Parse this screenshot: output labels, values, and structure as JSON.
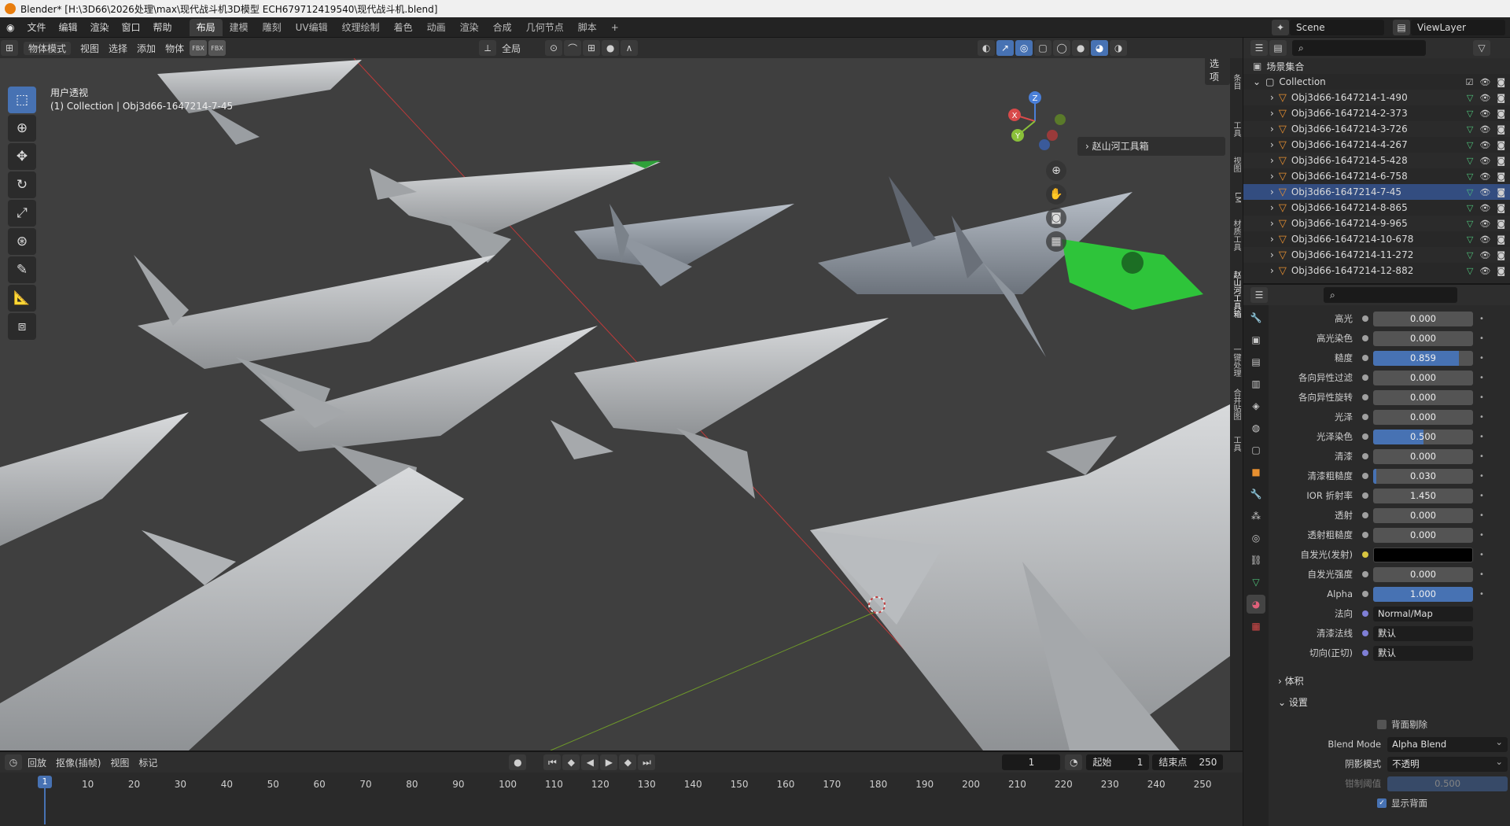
{
  "window": {
    "title": "Blender* [H:\\3D66\\2026处理\\max\\现代战斗机3D模型 ECH679712419540\\现代战斗机.blend]"
  },
  "topbar": {
    "menus": [
      "文件",
      "编辑",
      "渲染",
      "窗口",
      "帮助"
    ],
    "workspaces": [
      "布局",
      "建模",
      "雕刻",
      "UV编辑",
      "纹理绘制",
      "着色",
      "动画",
      "渲染",
      "合成",
      "几何节点",
      "脚本"
    ],
    "active_workspace": "布局",
    "add_tab": "+",
    "scene": "Scene",
    "view_layer": "ViewLayer"
  },
  "viewport_header": {
    "mode": "物体模式",
    "menus": [
      "视图",
      "选择",
      "添加",
      "物体"
    ],
    "transform_orientation": "全局",
    "options": "选项"
  },
  "viewport": {
    "view_name": "用户透视",
    "collection_info": "(1) Collection | Obj3d66-1647214-7-45",
    "npanel_title": "赵山河工具箱",
    "gizmo_axes": [
      "X",
      "Y",
      "Z"
    ],
    "side_tabs": [
      "条目",
      "工具",
      "视图",
      "LM",
      "材质工具",
      "赵山河工具箱",
      "一键处理",
      "合并贴图",
      "工具"
    ]
  },
  "outliner": {
    "scene_collection": "场景集合",
    "collection": "Collection",
    "objects": [
      "Obj3d66-1647214-1-490",
      "Obj3d66-1647214-2-373",
      "Obj3d66-1647214-3-726",
      "Obj3d66-1647214-4-267",
      "Obj3d66-1647214-5-428",
      "Obj3d66-1647214-6-758",
      "Obj3d66-1647214-7-45",
      "Obj3d66-1647214-8-865",
      "Obj3d66-1647214-9-965",
      "Obj3d66-1647214-10-678",
      "Obj3d66-1647214-11-272",
      "Obj3d66-1647214-12-882"
    ]
  },
  "properties": {
    "rows": [
      {
        "label": "高光",
        "value": "0.000",
        "fill": 0
      },
      {
        "label": "高光染色",
        "value": "0.000",
        "fill": 0
      },
      {
        "label": "糙度",
        "value": "0.859",
        "fill": 0.859
      },
      {
        "label": "各向异性过滤",
        "value": "0.000",
        "fill": 0
      },
      {
        "label": "各向异性旋转",
        "value": "0.000",
        "fill": 0
      },
      {
        "label": "光泽",
        "value": "0.000",
        "fill": 0
      },
      {
        "label": "光泽染色",
        "value": "0.500",
        "fill": 0.5
      },
      {
        "label": "清漆",
        "value": "0.000",
        "fill": 0
      },
      {
        "label": "清漆粗糙度",
        "value": "0.030",
        "fill": 0.03
      },
      {
        "label": "IOR 折射率",
        "value": "1.450",
        "fill": 0
      },
      {
        "label": "透射",
        "value": "0.000",
        "fill": 0
      },
      {
        "label": "透射粗糙度",
        "value": "0.000",
        "fill": 0
      },
      {
        "label": "自发光(发射)",
        "value": "",
        "fill": 0
      },
      {
        "label": "自发光强度",
        "value": "0.000",
        "fill": 0
      },
      {
        "label": "Alpha",
        "value": "1.000",
        "fill": 1
      },
      {
        "label": "法向",
        "value": "Normal/Map",
        "fill": 0
      },
      {
        "label": "清漆法线",
        "value": "默认",
        "fill": 0
      },
      {
        "label": "切向(正切)",
        "value": "默认",
        "fill": 0
      }
    ],
    "section_volume": "体积",
    "section_settings": "设置",
    "backface_culling": "背面剔除",
    "blend_mode_label": "Blend Mode",
    "blend_mode_value": "Alpha Blend",
    "shadow_mode_label": "阴影模式",
    "shadow_mode_value": "不透明",
    "clip_threshold_label": "钳制阈值",
    "clip_threshold_value": "0.500",
    "show_backface": "显示背面",
    "emission_color": "#000000"
  },
  "timeline": {
    "playback": "回放",
    "keying": "抠像(插帧)",
    "view": "视图",
    "marker": "标记",
    "current_frame": "1",
    "start_label": "起始",
    "start_value": "1",
    "end_label": "结束点",
    "end_value": "250",
    "playhead": "1",
    "ticks": [
      "10",
      "20",
      "30",
      "40",
      "50",
      "60",
      "70",
      "80",
      "90",
      "100",
      "110",
      "120",
      "130",
      "140",
      "150",
      "160",
      "170",
      "180",
      "190",
      "200",
      "210",
      "220",
      "230",
      "240",
      "250"
    ]
  },
  "colors": {
    "accent": "#4772b3",
    "object_icon": "#e89030",
    "jet_green": "#2ec43a"
  }
}
